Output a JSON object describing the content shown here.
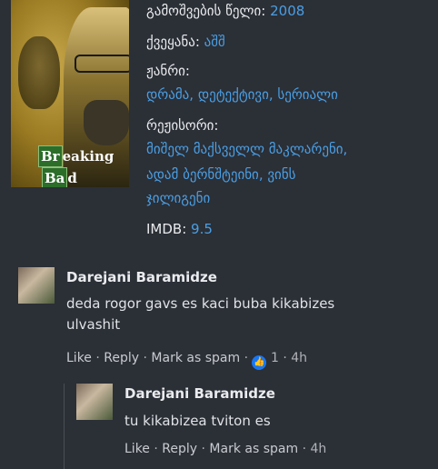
{
  "movie": {
    "year_label": "გამოშვების წელი:",
    "year_value": "2008",
    "country_label": "ქვეყანა:",
    "country_value": "აშშ",
    "genre_label": "ჟანრი:",
    "genre_value": "დრამა, დეტექტივი, სერიალი",
    "director_label": "რეჟისორი:",
    "director_line1": "მიშელ მაქსველლ მაკლარენი,",
    "director_line2": "ადამ ბერნშტეინი, ვინს",
    "director_line3": "ჯილიგენი",
    "imdb_label": "IMDB:",
    "imdb_value": "9.5",
    "poster_title_line1": "Breaking",
    "poster_title_line2": "Bad"
  },
  "comments": [
    {
      "author": "Darejani Baramidze",
      "text_line1": "deda rogor gavs es kaci buba kikabizes",
      "text_line2": "ulvashit",
      "like": "Like",
      "reply": "Reply",
      "spam": "Mark as spam",
      "like_count": "1",
      "time": "4h"
    },
    {
      "author": "Darejani Baramidze",
      "text_line1": "tu kikabizea tviton es",
      "like": "Like",
      "reply": "Reply",
      "spam": "Mark as spam",
      "time": "4h"
    }
  ],
  "colors": {
    "background": "#2b2f36",
    "link": "#4a9fe4",
    "like_badge": "#1877f2"
  }
}
